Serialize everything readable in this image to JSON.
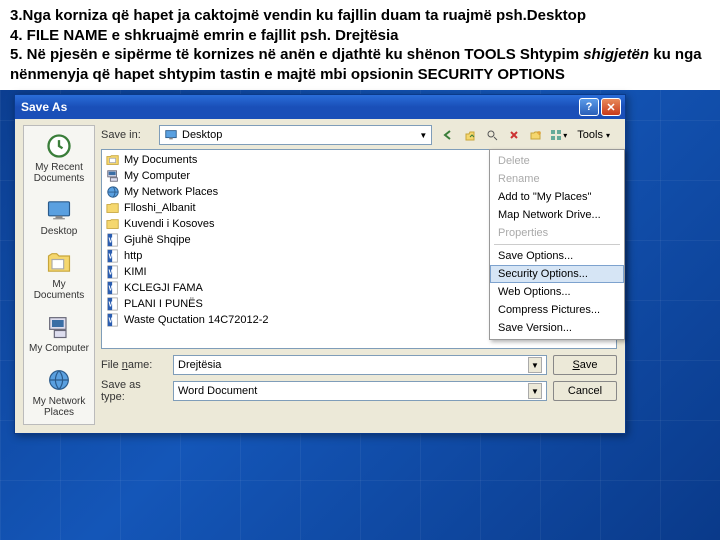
{
  "instructions": {
    "line1": "3.Nga korniza që hapet ja caktojmë vendin ku fajllin duam ta ruajmë psh.Desktop",
    "line2": "4. FILE NAME e shkruajmë emrin e fajllit psh. Drejtësia",
    "line3a": "5. Në pjesën e sipërme të kornizes në anën e djathtë ku shënon TOOLS Shtypim ",
    "line3b": "shigjetën",
    "line3c": " ku nga nënmenyja që hapet shtypim tastin e majtë mbi opsionin  SECURITY OPTIONS"
  },
  "dialog": {
    "title": "Save As",
    "help_icon": "?",
    "close_icon": "✕",
    "save_in_label": "Save in:",
    "save_in_value": "Desktop",
    "tools_label": "Tools",
    "places": [
      {
        "label": "My Recent Documents"
      },
      {
        "label": "Desktop"
      },
      {
        "label": "My Documents"
      },
      {
        "label": "My Computer"
      },
      {
        "label": "My Network Places"
      }
    ],
    "files": [
      {
        "name": "My Documents",
        "type": "folder-special"
      },
      {
        "name": "My Computer",
        "type": "computer"
      },
      {
        "name": "My Network Places",
        "type": "network"
      },
      {
        "name": "Flloshi_Albanit",
        "type": "folder"
      },
      {
        "name": "Kuvendi i Kosoves",
        "type": "folder"
      },
      {
        "name": "Gjuhë Shqipe",
        "type": "word"
      },
      {
        "name": "http",
        "type": "word"
      },
      {
        "name": "KIMI",
        "type": "word"
      },
      {
        "name": "KCLEGJI FAMA",
        "type": "word"
      },
      {
        "name": "PLANI I PUNËS",
        "type": "word"
      },
      {
        "name": "Waste Quctation 14C72012-2",
        "type": "word"
      }
    ],
    "file_name_label": "File name:",
    "file_name_value": "Drejtësia",
    "save_type_label": "Save as type:",
    "save_type_value": "Word Document",
    "save_btn": "Save",
    "cancel_btn": "Cancel",
    "tools_menu": [
      {
        "label": "Delete",
        "disabled": true
      },
      {
        "label": "Rename",
        "disabled": true
      },
      {
        "label": "Add to \"My Places\""
      },
      {
        "label": "Map Network Drive..."
      },
      {
        "label": "Properties",
        "disabled": true
      },
      {
        "sep": true
      },
      {
        "label": "Save Options..."
      },
      {
        "label": "Security Options...",
        "highlight": true
      },
      {
        "label": "Web Options..."
      },
      {
        "label": "Compress Pictures..."
      },
      {
        "label": "Save Version..."
      }
    ]
  }
}
